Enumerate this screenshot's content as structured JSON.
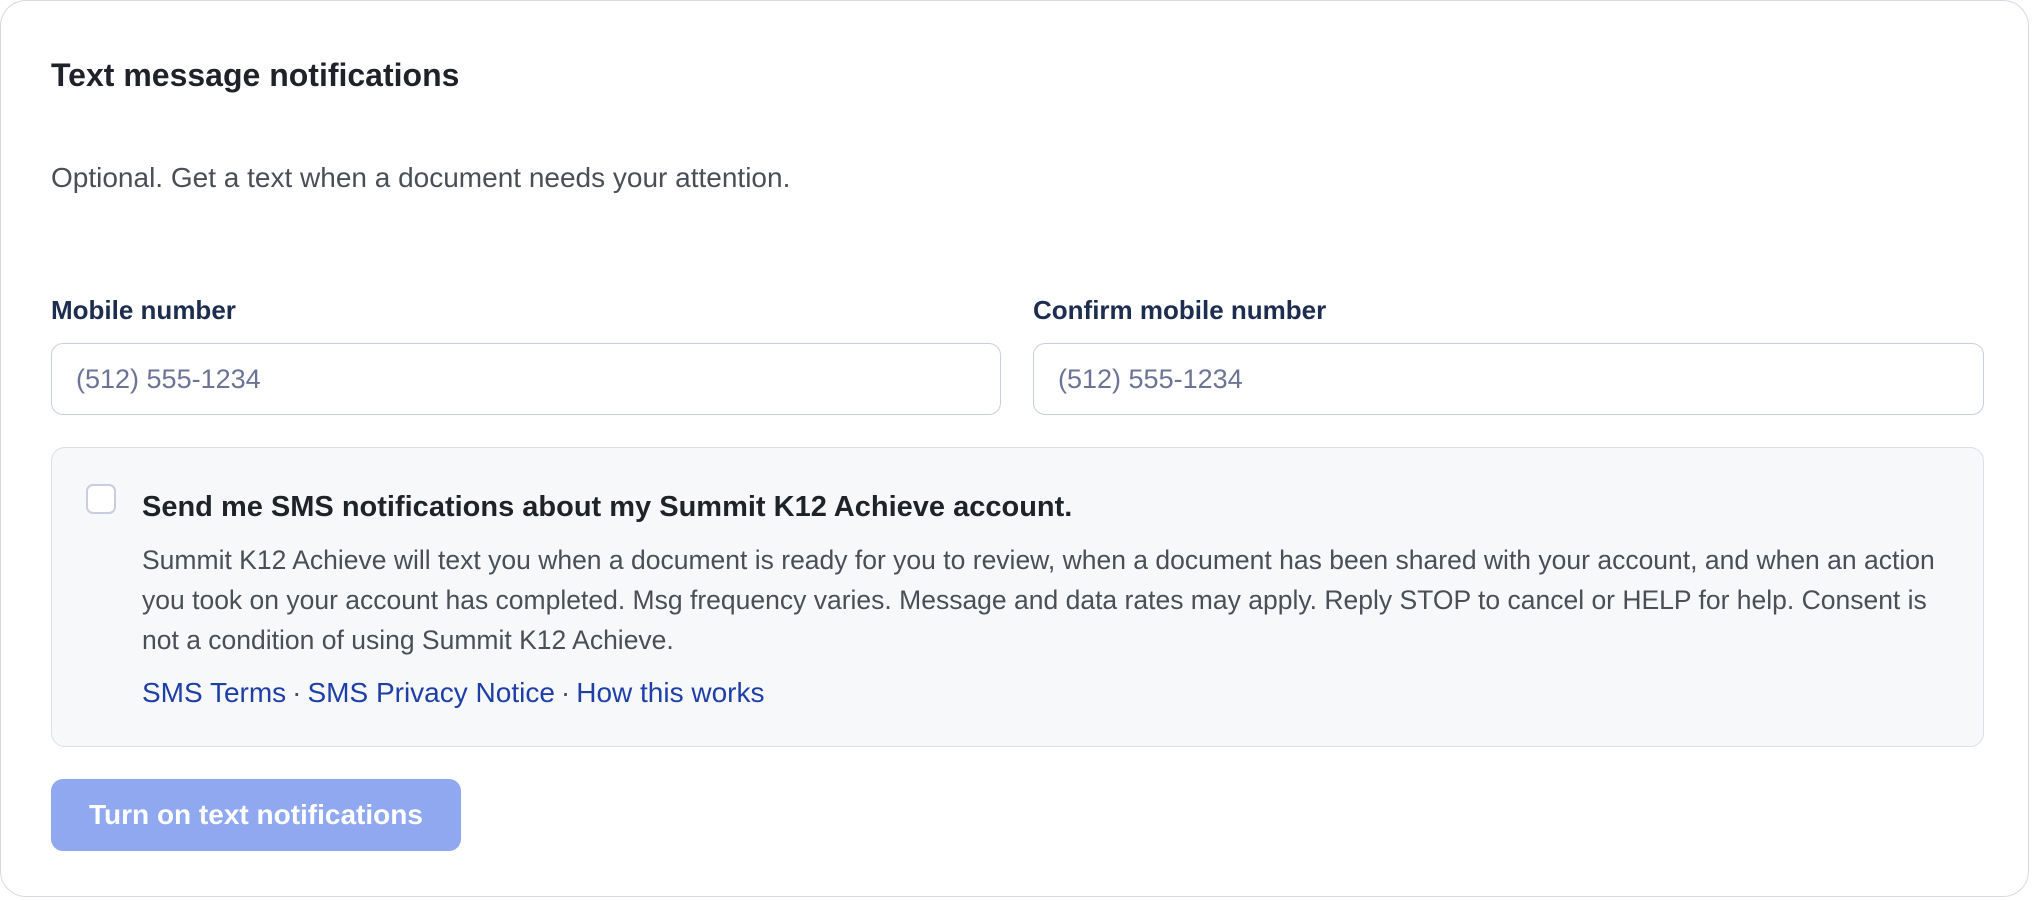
{
  "section": {
    "title": "Text message notifications",
    "subtitle": "Optional. Get a text when a document needs your attention."
  },
  "fields": {
    "mobile": {
      "label": "Mobile number",
      "placeholder": "(512) 555-1234",
      "value": ""
    },
    "confirm": {
      "label": "Confirm mobile number",
      "placeholder": "(512) 555-1234",
      "value": ""
    }
  },
  "consent": {
    "checked": false,
    "heading": "Send me SMS notifications about my Summit K12 Achieve account.",
    "body": "Summit K12 Achieve will text you when a document is ready for you to review, when a document has been shared with your account, and when an action you took on your account has completed. Msg frequency varies. Message and data rates may apply. Reply STOP to cancel or HELP for help. Consent is not a condition of using Summit K12 Achieve.",
    "links": {
      "terms": "SMS Terms",
      "privacy": "SMS Privacy Notice",
      "how": "How this works",
      "separator": "·"
    }
  },
  "actions": {
    "submit_label": "Turn on text notifications",
    "submit_disabled": true
  },
  "colors": {
    "primary_disabled": "#8fa8f0",
    "link": "#1f3fa8",
    "label": "#1c2d4f",
    "border": "#c9cde0"
  }
}
